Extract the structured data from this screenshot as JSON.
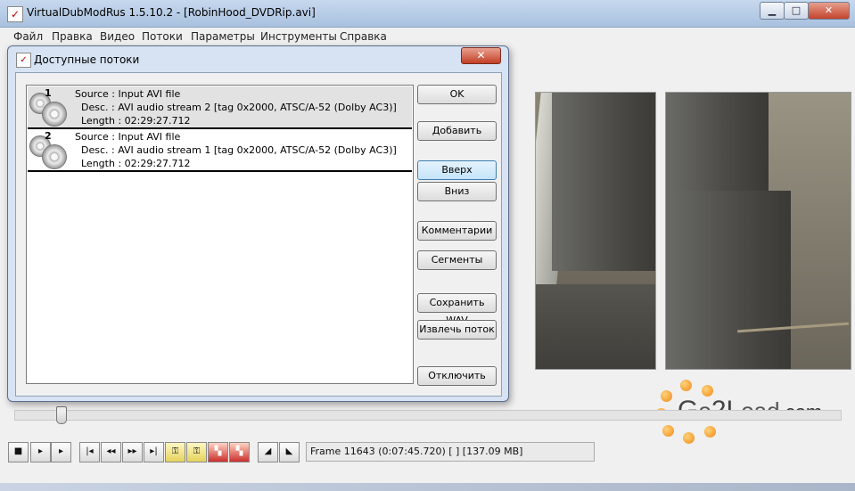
{
  "window": {
    "title": "VirtualDubModRus 1.5.10.2 - [RobinHood_DVDRip.avi]",
    "minimize_glyph": "▁",
    "maximize_glyph": "□",
    "close_glyph": "✕"
  },
  "menu": [
    "Файл",
    "Правка",
    "Видео",
    "Потоки",
    "Параметры",
    "Инструменты",
    "Справка"
  ],
  "dialog": {
    "title": "Доступные потоки",
    "close_glyph": "✕",
    "streams": [
      {
        "number": "1",
        "source": "Source : Input AVI file",
        "desc": "Desc. : AVI audio stream 2 [tag 0x2000, ATSC/A-52 (Dolby AC3)]",
        "length": "Length : 02:29:27.712",
        "selected": true
      },
      {
        "number": "2",
        "source": "Source : Input AVI file",
        "desc": "Desc. : AVI audio stream 1 [tag 0x2000, ATSC/A-52 (Dolby AC3)]",
        "length": "Length : 02:29:27.712",
        "selected": false
      }
    ],
    "buttons": {
      "ok": "OK",
      "add": "Добавить",
      "up": "Вверх",
      "down": "Вниз",
      "comments": "Комментарии",
      "segments": "Сегменты",
      "save_wav": "Сохранить WAV",
      "extract": "Извлечь поток",
      "disable": "Отключить"
    }
  },
  "watermark": {
    "brand_g": "G",
    "brand_o": "o",
    "brand_2": "2",
    "brand_l": "L",
    "brand_oad": "oad",
    "brand_com": ".com"
  },
  "position_slider": {
    "fraction": 0.05
  },
  "toolbar_icons": [
    "stop-icon",
    "play-input-icon",
    "play-output-icon",
    "go-start-icon",
    "prev-frame-icon",
    "next-frame-icon",
    "go-end-icon",
    "prev-keyframe-icon",
    "next-keyframe-icon",
    "prev-scene-icon",
    "next-scene-icon",
    "mark-in-icon",
    "mark-out-icon"
  ],
  "status": {
    "frame_text": "Frame 11643 (0:07:45.720) [ ] [137.09 MB]"
  },
  "colors": {
    "dialog_frame": "#d7e3f3",
    "selected_row": "#e2e2e2",
    "accent_button": "#c4e4f8"
  }
}
